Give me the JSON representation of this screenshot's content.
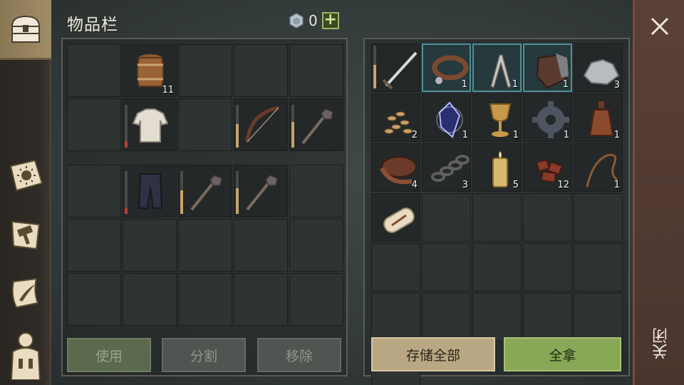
{
  "header": {
    "title": "物品栏",
    "currency_value": "0",
    "add_label": "+"
  },
  "nav": [
    {
      "name": "nav-tab-inventory",
      "icon": "chest-icon",
      "active": true
    },
    {
      "name": "nav-tab-journal",
      "icon": "sun-book-icon",
      "active": false
    },
    {
      "name": "nav-tab-crafting",
      "icon": "hammer-icon",
      "active": false
    },
    {
      "name": "nav-tab-quests",
      "icon": "scroll-quill-icon",
      "active": false
    },
    {
      "name": "nav-tab-character",
      "icon": "character-icon",
      "active": false
    }
  ],
  "player_inventory": {
    "slots": [
      {
        "item": "",
        "qty": ""
      },
      {
        "item": "barrel-icon",
        "qty": "11"
      },
      {
        "item": "",
        "qty": ""
      },
      {
        "item": "",
        "qty": ""
      },
      {
        "item": "",
        "qty": ""
      },
      {
        "item": "",
        "qty": ""
      },
      {
        "item": "shirt-icon",
        "qty": "",
        "durability": 0.15,
        "red": true
      },
      {
        "item": "",
        "qty": ""
      },
      {
        "item": "bow-icon",
        "qty": "",
        "durability": 0.55
      },
      {
        "item": "mace-icon",
        "qty": "",
        "durability": 0.6
      },
      {
        "item": "",
        "qty": ""
      },
      {
        "item": "pants-icon",
        "qty": "",
        "durability": 0.15,
        "red": true
      },
      {
        "item": "mace-icon",
        "qty": "",
        "durability": 0.55
      },
      {
        "item": "mace-icon",
        "qty": "",
        "durability": 0.6
      },
      {
        "item": "",
        "qty": ""
      }
    ]
  },
  "chest_inventory": {
    "slots": [
      {
        "item": "sword-icon",
        "qty": "",
        "durability": 0.55
      },
      {
        "item": "collar-icon",
        "qty": "1",
        "selected": true
      },
      {
        "item": "pliers-icon",
        "qty": "1",
        "selected": true
      },
      {
        "item": "gauntlet-icon",
        "qty": "1",
        "selected": true
      },
      {
        "item": "ore-icon",
        "qty": "3"
      },
      {
        "item": "seeds-icon",
        "qty": "2"
      },
      {
        "item": "crystal-icon",
        "qty": "1"
      },
      {
        "item": "goblet-icon",
        "qty": "1"
      },
      {
        "item": "gear-icon",
        "qty": "1"
      },
      {
        "item": "bottle-icon",
        "qty": "1"
      },
      {
        "item": "leather-icon",
        "qty": "4"
      },
      {
        "item": "chain-icon",
        "qty": "3"
      },
      {
        "item": "candle-icon",
        "qty": "5"
      },
      {
        "item": "scrap-icon",
        "qty": "12"
      },
      {
        "item": "rope-icon",
        "qty": "1"
      },
      {
        "item": "scroll-icon",
        "qty": ""
      }
    ]
  },
  "buttons": {
    "use": "使用",
    "split": "分割",
    "remove": "移除",
    "store_all": "存储全部",
    "take_all": "全拿",
    "close": "关闭"
  }
}
